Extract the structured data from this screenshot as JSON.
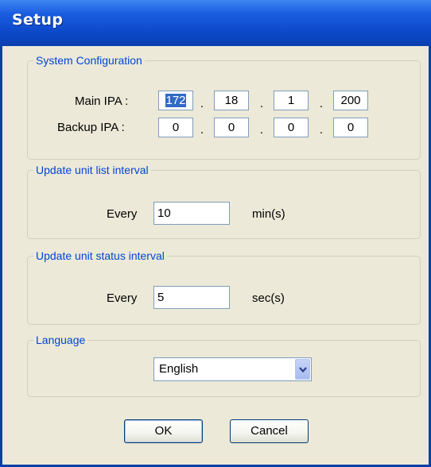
{
  "window": {
    "title": "Setup"
  },
  "system_configuration": {
    "legend": "System Configuration",
    "main_ipa": {
      "label": "Main IPA :",
      "octets": [
        "172",
        "18",
        "1",
        "200"
      ]
    },
    "backup_ipa": {
      "label": "Backup IPA :",
      "octets": [
        "0",
        "0",
        "0",
        "0"
      ]
    },
    "separator": "."
  },
  "update_unit_list": {
    "legend": "Update unit list interval",
    "prefix": "Every",
    "value": "10",
    "unit": "min(s)"
  },
  "update_unit_status": {
    "legend": "Update unit status interval",
    "prefix": "Every",
    "value": "5",
    "unit": "sec(s)"
  },
  "language": {
    "legend": "Language",
    "selected": "English"
  },
  "buttons": {
    "ok": "OK",
    "cancel": "Cancel"
  }
}
